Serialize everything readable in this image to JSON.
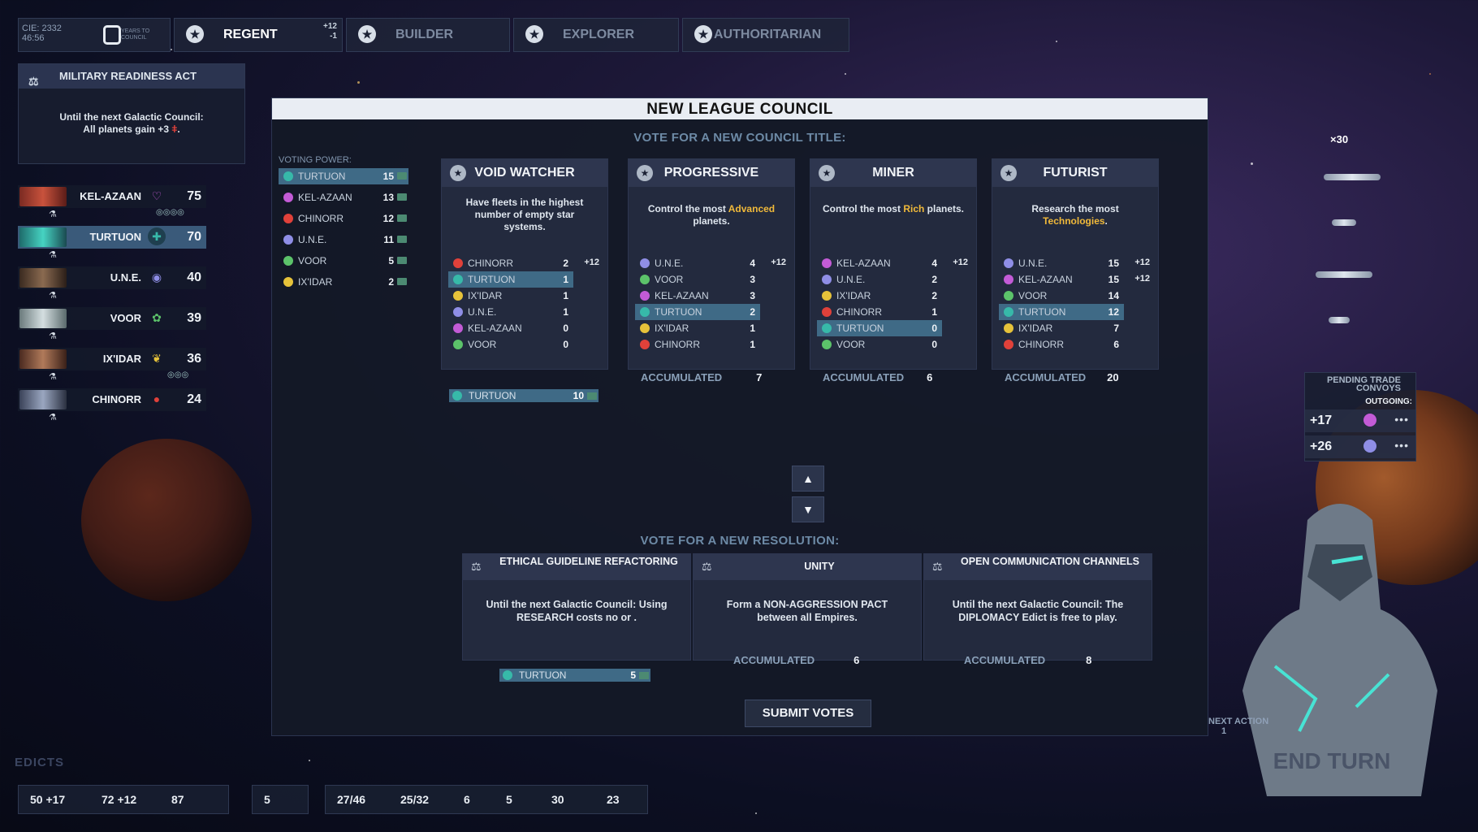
{
  "top": {
    "cie": "CIE: 2332",
    "cie_sub": "46:56",
    "years_value": "0",
    "years_label": "YEARS TO COUNCIL",
    "tabs": [
      {
        "label": "REGENT",
        "bonus_top": "+12",
        "bonus_bottom": "-1"
      },
      {
        "label": "BUILDER"
      },
      {
        "label": "EXPLORER"
      },
      {
        "label": "AUTHORITARIAN"
      }
    ]
  },
  "edict": {
    "title": "MILITARY READINESS ACT",
    "line1": "Until the next Galactic Council:",
    "line2": "All planets gain +3"
  },
  "empires": [
    {
      "name": "KEL-AZAAN",
      "score": "75",
      "color": "#c35bd6"
    },
    {
      "name": "TURTUON",
      "score": "70",
      "color": "#37b9a9"
    },
    {
      "name": "U.N.E.",
      "score": "40",
      "color": "#8f8ee6"
    },
    {
      "name": "VOOR",
      "score": "39",
      "color": "#5cc36a"
    },
    {
      "name": "IX'IDAR",
      "score": "36",
      "color": "#e6c23a"
    },
    {
      "name": "CHINORR",
      "score": "24",
      "color": "#e0413a"
    }
  ],
  "council": {
    "title": "NEW LEAGUE COUNCIL",
    "vote_title": "VOTE FOR A NEW COUNCIL TITLE:",
    "voting_power_label": "VOTING POWER:",
    "voting_power": [
      {
        "name": "TURTUON",
        "value": "15"
      },
      {
        "name": "KEL-AZAAN",
        "value": "13"
      },
      {
        "name": "CHINORR",
        "value": "12"
      },
      {
        "name": "U.N.E.",
        "value": "11"
      },
      {
        "name": "VOOR",
        "value": "5"
      },
      {
        "name": "IX'IDAR",
        "value": "2"
      }
    ],
    "titles": [
      {
        "name": "VOID WATCHER",
        "desc": "Have fleets in the highest number of empty star systems.",
        "rows": [
          [
            "CHINORR",
            "2",
            "+12"
          ],
          [
            "TURTUON",
            "1",
            ""
          ],
          [
            "IX'IDAR",
            "1",
            ""
          ],
          [
            "U.N.E.",
            "1",
            ""
          ],
          [
            "KEL-AZAAN",
            "0",
            ""
          ],
          [
            "VOOR",
            "0",
            ""
          ]
        ],
        "selected": {
          "name": "TURTUON",
          "value": "10"
        }
      },
      {
        "name": "PROGRESSIVE",
        "desc_a": "Control the most ",
        "desc_b": "Advanced",
        "desc_c": " planets.",
        "rows": [
          [
            "U.N.E.",
            "4",
            "+12"
          ],
          [
            "VOOR",
            "3",
            ""
          ],
          [
            "KEL-AZAAN",
            "3",
            ""
          ],
          [
            "TURTUON",
            "2",
            ""
          ],
          [
            "IX'IDAR",
            "1",
            ""
          ],
          [
            "CHINORR",
            "1",
            ""
          ]
        ],
        "accumulated_label": "ACCUMULATED",
        "accumulated": "7"
      },
      {
        "name": "MINER",
        "desc_a": "Control the most ",
        "desc_b": "Rich",
        "desc_c": " planets.",
        "rows": [
          [
            "KEL-AZAAN",
            "4",
            "+12"
          ],
          [
            "U.N.E.",
            "2",
            ""
          ],
          [
            "IX'IDAR",
            "2",
            ""
          ],
          [
            "CHINORR",
            "1",
            ""
          ],
          [
            "TURTUON",
            "0",
            ""
          ],
          [
            "VOOR",
            "0",
            ""
          ]
        ],
        "accumulated_label": "ACCUMULATED",
        "accumulated": "6"
      },
      {
        "name": "FUTURIST",
        "desc_a": "Research the most ",
        "desc_b": "Technologies",
        "desc_c": ".",
        "rows": [
          [
            "U.N.E.",
            "15",
            "+12"
          ],
          [
            "KEL-AZAAN",
            "15",
            "+12"
          ],
          [
            "VOOR",
            "14",
            ""
          ],
          [
            "TURTUON",
            "12",
            ""
          ],
          [
            "IX'IDAR",
            "7",
            ""
          ],
          [
            "CHINORR",
            "6",
            ""
          ]
        ],
        "accumulated_label": "ACCUMULATED",
        "accumulated": "20"
      }
    ],
    "resolution_title": "VOTE FOR A NEW RESOLUTION:",
    "resolutions": [
      {
        "name": "ETHICAL GUIDELINE REFACTORING",
        "desc": "Until the next Galactic Council: Using RESEARCH costs no or .",
        "selected": {
          "name": "TURTUON",
          "value": "5"
        }
      },
      {
        "name": "UNITY",
        "desc": "Form a NON-AGGRESSION PACT between all Empires.",
        "accumulated_label": "ACCUMULATED",
        "accumulated": "6"
      },
      {
        "name": "OPEN COMMUNICATION CHANNELS",
        "desc": "Until the next Galactic Council: The DIPLOMACY Edict is free to play.",
        "accumulated_label": "ACCUMULATED",
        "accumulated": "8"
      }
    ],
    "submit": "SUBMIT VOTES"
  },
  "fleets": {
    "count": "×30"
  },
  "trade": {
    "title": "PENDING TRADE CONVOYS",
    "outgoing": "OUTGOING:",
    "items": [
      "+17",
      "+26"
    ]
  },
  "next_action": {
    "label": "NEXT ACTION",
    "count": "1"
  },
  "end_turn": "END TURN",
  "edicts_label": "EDICTS",
  "bottom": {
    "pop": "50 +17",
    "ind": "72 +12",
    "cred": "87",
    "inf": "5",
    "food": "27/46",
    "sci": "25/32",
    "trade": "6",
    "mil": "5",
    "vote": "30",
    "tox": "23"
  }
}
